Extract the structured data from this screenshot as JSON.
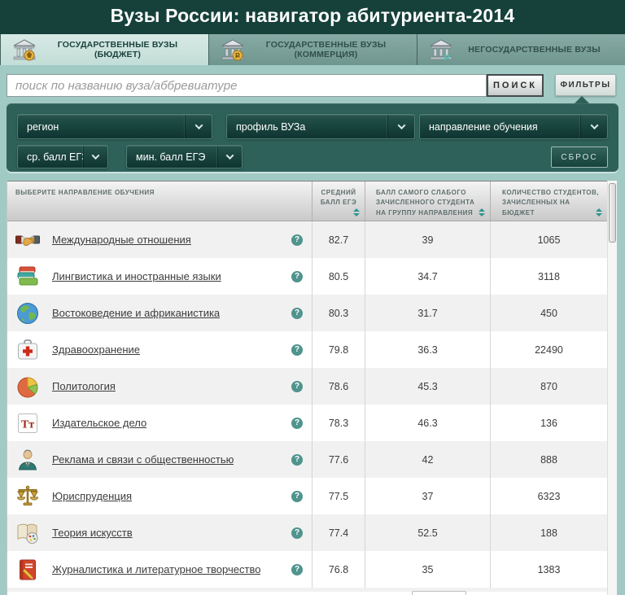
{
  "app": {
    "title": "Вузы России: навигатор абитуриента-2014"
  },
  "tabs": [
    {
      "label": "ГОСУДАРСТВЕННЫЕ ВУЗЫ (БЮДЖЕТ)",
      "icon": "bank-budget-icon",
      "active": true
    },
    {
      "label": "ГОСУДАРСТВЕННЫЕ ВУЗЫ (КОММЕРЦИЯ)",
      "icon": "bank-commerce-icon",
      "active": false
    },
    {
      "label": "НЕГОСУДАРСТВЕННЫЕ ВУЗЫ",
      "icon": "bank-private-icon",
      "active": false
    }
  ],
  "search": {
    "placeholder": "поиск по названию вуза/аббревиатуре",
    "value": "",
    "search_button": "ПОИСК",
    "filters_button": "ФИЛЬТРЫ"
  },
  "filters": {
    "dropdowns": [
      {
        "label": "регион"
      },
      {
        "label": "профиль ВУЗа"
      },
      {
        "label": "направление обучения"
      },
      {
        "label": "ср. балл ЕГЭ"
      },
      {
        "label": "мин. балл ЕГЭ"
      }
    ],
    "reset_button": "СБРОС"
  },
  "table": {
    "columns": [
      {
        "label": "ВЫБЕРИТЕ НАПРАВЛЕНИЕ ОБУЧЕНИЯ",
        "sortable": false
      },
      {
        "label": "СРЕДНИЙ БАЛЛ ЕГЭ",
        "sortable": true
      },
      {
        "label": "БАЛЛ САМОГО СЛАБОГО ЗАЧИСЛЕННОГО СТУДЕНТА НА ГРУППУ НАПРАВЛЕНИЯ",
        "sortable": true
      },
      {
        "label": "КОЛИЧЕСТВО СТУДЕНТОВ, ЗАЧИСЛЕННЫХ НА БЮДЖЕТ",
        "sortable": true
      }
    ],
    "rows": [
      {
        "icon": "handshake-icon",
        "name": "Международные отношения",
        "avg": "82.7",
        "min": "39",
        "count": "1065"
      },
      {
        "icon": "books-icon",
        "name": "Лингвистика и иностранные языки",
        "avg": "80.5",
        "min": "34.7",
        "count": "3118"
      },
      {
        "icon": "globe-icon",
        "name": "Востоковедение и африканистика",
        "avg": "80.3",
        "min": "31.7",
        "count": "450"
      },
      {
        "icon": "medkit-icon",
        "name": "Здравоохранение",
        "avg": "79.8",
        "min": "36.3",
        "count": "22490"
      },
      {
        "icon": "piechart-icon",
        "name": "Политология",
        "avg": "78.6",
        "min": "45.3",
        "count": "870"
      },
      {
        "icon": "letters-icon",
        "name": "Издательское дело",
        "avg": "78.3",
        "min": "46.3",
        "count": "136"
      },
      {
        "icon": "person-icon",
        "name": "Реклама и связи с общественностью",
        "avg": "77.6",
        "min": "42",
        "count": "888"
      },
      {
        "icon": "scales-icon",
        "name": "Юриспруденция",
        "avg": "77.5",
        "min": "37",
        "count": "6323"
      },
      {
        "icon": "art-book-icon",
        "name": "Теория искусств",
        "avg": "77.4",
        "min": "52.5",
        "count": "188"
      },
      {
        "icon": "journal-icon",
        "name": "Журналистика и литературное творчество",
        "avg": "76.8",
        "min": "35",
        "count": "1383"
      }
    ]
  },
  "colors": {
    "header_bg": "#16413b",
    "page_bg": "#a2cac4",
    "panel_bg": "#2e6159",
    "active_tab_bg": "#cde4e0",
    "inactive_tab_bg": "#7ea69f",
    "accent_teal": "#2f958d",
    "help_icon": "#4f948d",
    "row_alt": "#f1f1f1",
    "link": "#3c3c3c"
  }
}
